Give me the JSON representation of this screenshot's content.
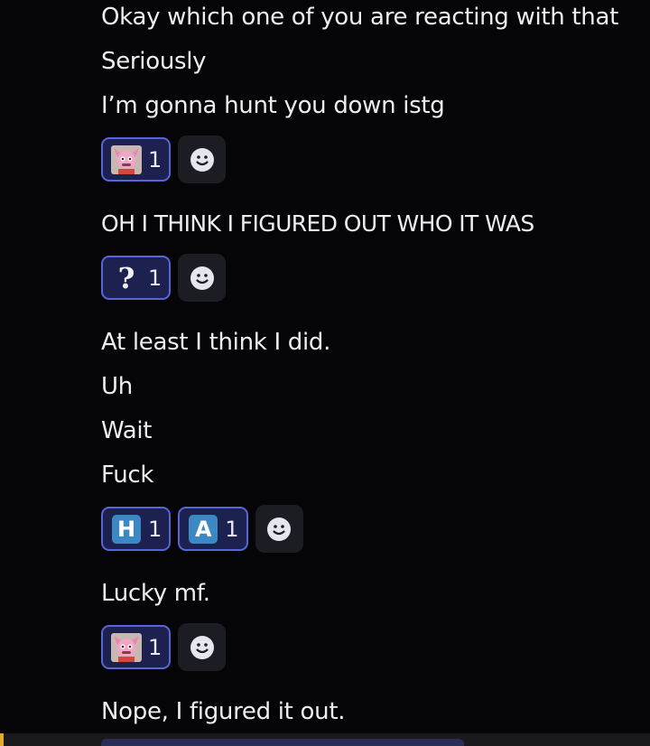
{
  "messages": [
    "Okay which one of you are reacting with that",
    "Seriously",
    "I’m gonna hunt you down istg",
    "OH I THINK I FIGURED OUT WHO IT WAS",
    "At least I think I did.",
    "Uh",
    "Wait",
    "Fuck",
    "Lucky mf.",
    "Nope, I figured it out."
  ],
  "reactions": {
    "r1": {
      "emoji": "pink-character-emoji",
      "count": "1"
    },
    "r2": {
      "emoji": "question-mark-emoji",
      "count": "1",
      "glyph": "?"
    },
    "r3": [
      {
        "emoji": "regional-h-emoji",
        "count": "1",
        "glyph": "H"
      },
      {
        "emoji": "regional-a-emoji",
        "count": "1",
        "glyph": "A"
      }
    ],
    "r4": {
      "emoji": "pink-character-emoji",
      "count": "1"
    }
  },
  "colors": {
    "background": "#050507",
    "reaction_border": "#5865d8",
    "reaction_fill": "#1d2150",
    "letter_emoji": "#3b88c3",
    "accent": "#e2a92a"
  }
}
